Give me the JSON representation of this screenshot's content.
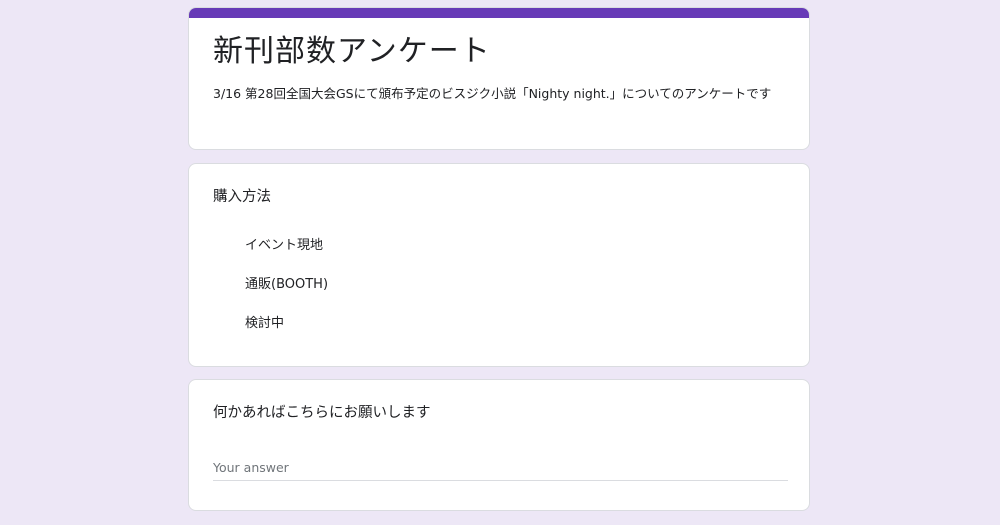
{
  "form": {
    "title": "新刊部数アンケート",
    "description": "3/16 第28回全国大会GSにて頒布予定のビスジク小説「Nighty night.」についてのアンケートです",
    "accent_color": "#673ab7",
    "background_color": "#ede7f6"
  },
  "questions": [
    {
      "title": "購入方法",
      "type": "radio",
      "options": [
        "イベント現地",
        "通販(BOOTH)",
        "検討中"
      ]
    },
    {
      "title": "何かあればこちらにお願いします",
      "type": "text",
      "placeholder": "Your answer"
    }
  ]
}
